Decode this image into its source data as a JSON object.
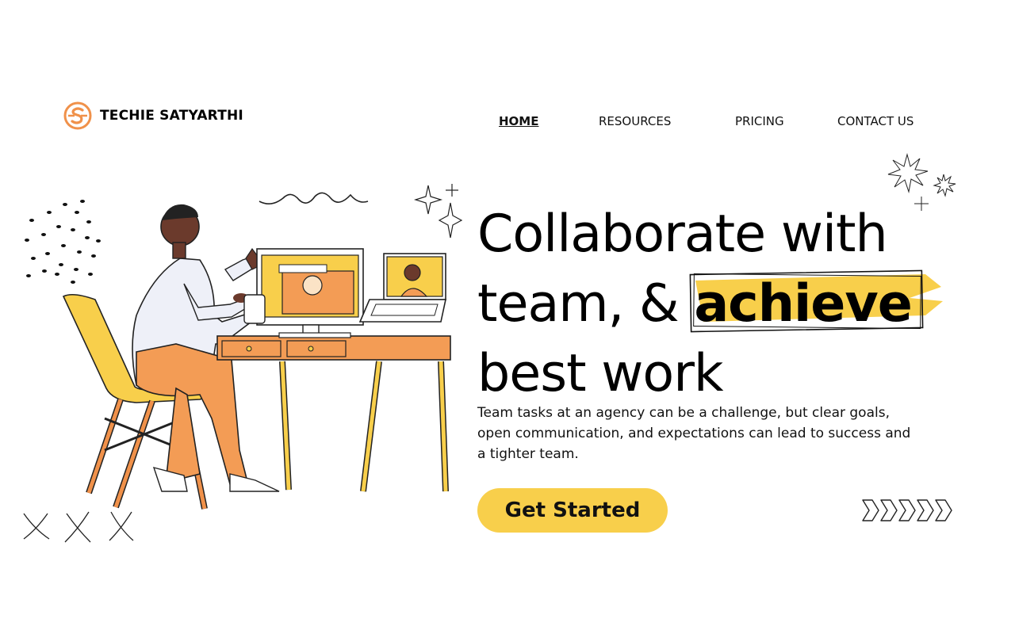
{
  "brand": {
    "name": "TECHIE SATYARTHI",
    "logo_icon": "s-letter-logo-icon"
  },
  "nav": {
    "items": [
      {
        "label": "HOME",
        "active": true
      },
      {
        "label": "RESOURCES",
        "active": false
      },
      {
        "label": "PRICING",
        "active": false
      },
      {
        "label": "CONTACT US",
        "active": false
      }
    ]
  },
  "hero": {
    "headline_line1": "Collaborate with",
    "headline_line2_prefix": "team, &",
    "headline_highlight": "achieve",
    "headline_line3": "best work",
    "description": "Team tasks at an agency can be a challenge, but clear goals, open communication, and expectations can lead to success and a tighter team.",
    "cta_label": "Get Started"
  },
  "colors": {
    "accent_yellow": "#f8cf4b",
    "logo_orange": "#f0914a",
    "text": "#000000",
    "background": "#ffffff"
  }
}
